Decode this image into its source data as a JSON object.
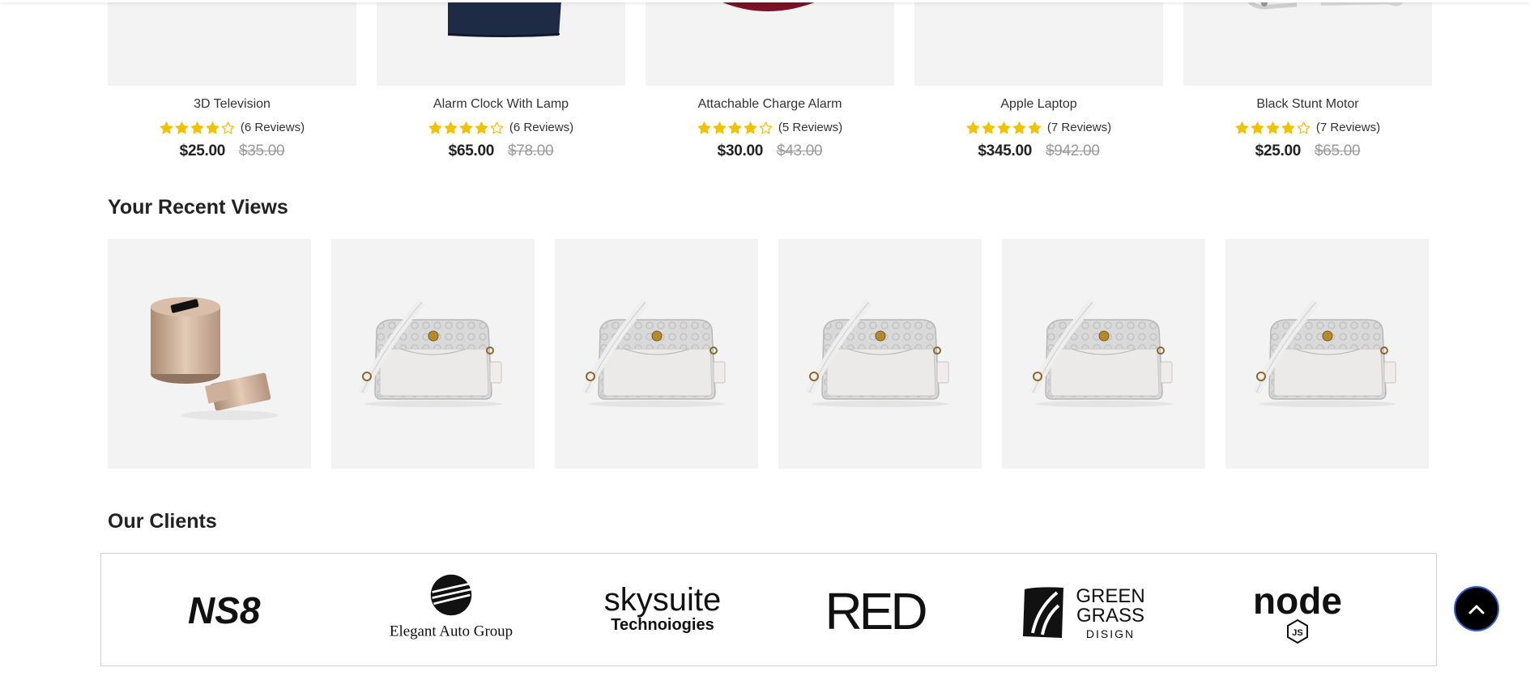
{
  "products": [
    {
      "name": "3D Television",
      "rating": 4,
      "reviews": "(6 Reviews)",
      "price": "$25.00",
      "old_price": "$35.00",
      "image": "product-image"
    },
    {
      "name": "Alarm Clock With Lamp",
      "rating": 4,
      "reviews": "(6 Reviews)",
      "price": "$65.00",
      "old_price": "$78.00",
      "image": "navy-garment-image"
    },
    {
      "name": "Attachable Charge Alarm",
      "rating": 4,
      "reviews": "(5 Reviews)",
      "price": "$30.00",
      "old_price": "$43.00",
      "image": "red-item-image"
    },
    {
      "name": "Apple Laptop",
      "rating": 5,
      "reviews": "(7 Reviews)",
      "price": "$345.00",
      "old_price": "$942.00",
      "image": "product-image"
    },
    {
      "name": "Black Stunt Motor",
      "rating": 4,
      "reviews": "(7 Reviews)",
      "price": "$25.00",
      "old_price": "$65.00",
      "image": "white-item-image"
    }
  ],
  "recent_views": {
    "title": "Your Recent Views",
    "items": [
      "usb-drive-image",
      "handbag-image",
      "handbag-image",
      "handbag-image",
      "handbag-image",
      "handbag-image"
    ]
  },
  "clients": {
    "title": "Our Clients",
    "logos": [
      {
        "name": "nso-logo",
        "text": "NS8"
      },
      {
        "name": "elegant-auto-group-logo",
        "text": "Elegant Auto Group"
      },
      {
        "name": "skysuite-logo",
        "text": "skysuite",
        "subtext": "Technoiogies"
      },
      {
        "name": "red-logo",
        "text": "RED"
      },
      {
        "name": "green-grass-logo",
        "text": "GREEN",
        "text2": "GRASS",
        "subtext": "DISIGN"
      },
      {
        "name": "node-js-logo",
        "text": "node",
        "subtext": "JS"
      }
    ]
  },
  "colors": {
    "star": "#f2c200",
    "card_bg": "#f3f3f3",
    "back_top_border": "#2f5fd1"
  }
}
